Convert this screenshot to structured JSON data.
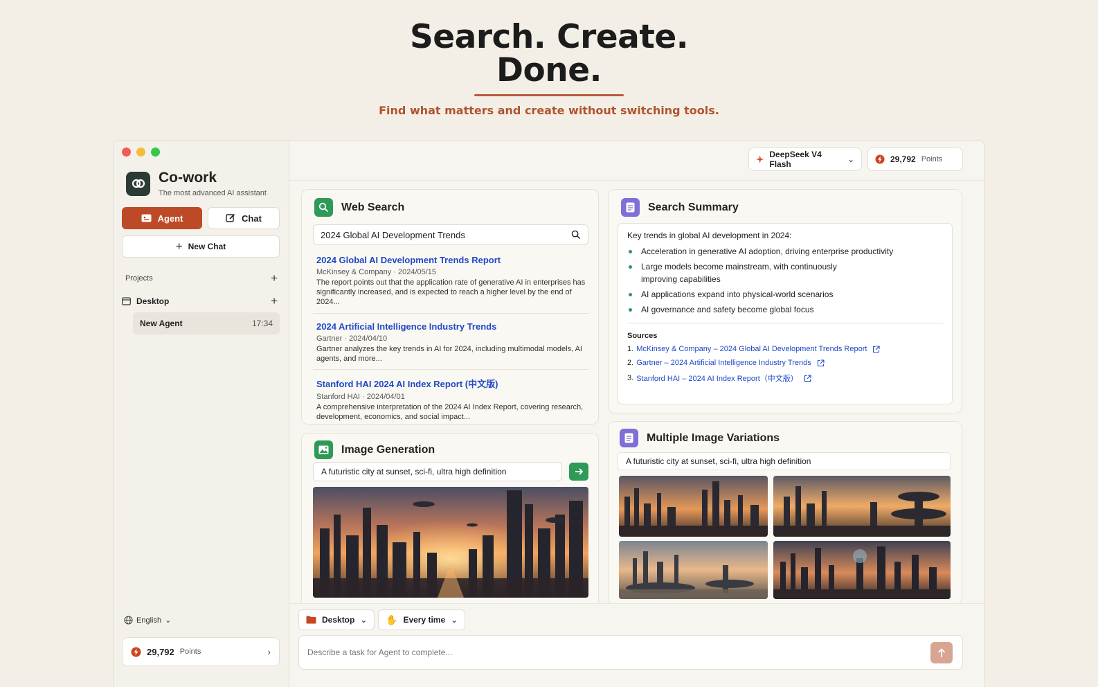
{
  "hero": {
    "title_line1": "Search. Create.",
    "title_line2": "Done.",
    "subtitle": "Find what matters and create without switching tools."
  },
  "colors": {
    "accent": "#bd4a26",
    "link": "#1f49c6",
    "green": "#2f9a58",
    "purple": "#7f6fd6",
    "background": "#f3efe6"
  },
  "sidebar": {
    "app_name": "Co-work",
    "tagline": "The most advanced AI assistant",
    "agent_label": "Agent",
    "chat_label": "Chat",
    "new_chat_label": "New Chat",
    "projects_label": "Projects",
    "desktop_label": "Desktop",
    "agent_item": {
      "label": "New Agent",
      "time": "17:34"
    },
    "language": "English",
    "points": {
      "value": "29,792",
      "label": "Points"
    }
  },
  "topbar": {
    "model": "DeepSeek V4 Flash",
    "points_value": "29,792",
    "points_label": "Points"
  },
  "web_search": {
    "title": "Web Search",
    "query": "2024 Global AI Development Trends",
    "results": [
      {
        "title": "2024 Global AI Development Trends Report",
        "meta": "McKinsey & Company · 2024/05/15",
        "desc": "The report points out that the application rate of generative AI in enterprises has significantly increased, and is expected to reach a higher level by the end of 2024..."
      },
      {
        "title": "2024 Artificial Intelligence Industry Trends",
        "meta": "Gartner · 2024/04/10",
        "desc": "Gartner analyzes the key trends in AI for 2024, including multimodal models, AI agents, and more..."
      },
      {
        "title": "Stanford HAI 2024 AI Index Report (中文版)",
        "meta": "Stanford HAI · 2024/04/01",
        "desc": "A comprehensive interpretation of the 2024 AI Index Report, covering research, development, economics, and social impact..."
      }
    ]
  },
  "image_generation": {
    "title": "Image Generation",
    "prompt": "A futuristic city at sunset, sci-fi, ultra high definition"
  },
  "summary": {
    "title": "Search Summary",
    "intro": "Key trends in global AI development in 2024:",
    "bullets": [
      "Acceleration in generative AI adoption, driving enterprise productivity",
      "Large models become mainstream, with continuously improving capabilities",
      "AI applications expand into physical-world scenarios",
      "AI governance and safety become global focus"
    ],
    "sources_label": "Sources",
    "sources": [
      {
        "num": "1.",
        "text": "McKinsey & Company – 2024 Global AI Development Trends Report"
      },
      {
        "num": "2.",
        "text": "Gartner – 2024 Artificial Intelligence Industry Trends"
      },
      {
        "num": "3.",
        "text": "Stanford HAI – 2024 AI Index Report（中文版）"
      }
    ]
  },
  "variations": {
    "title": "Multiple Image Variations",
    "prompt": "A futuristic city at sunset, sci-fi, ultra high definition"
  },
  "bottom": {
    "location_chip": "Desktop",
    "frequency_chip": "Every time",
    "task_placeholder": "Describe a task for Agent to complete..."
  }
}
